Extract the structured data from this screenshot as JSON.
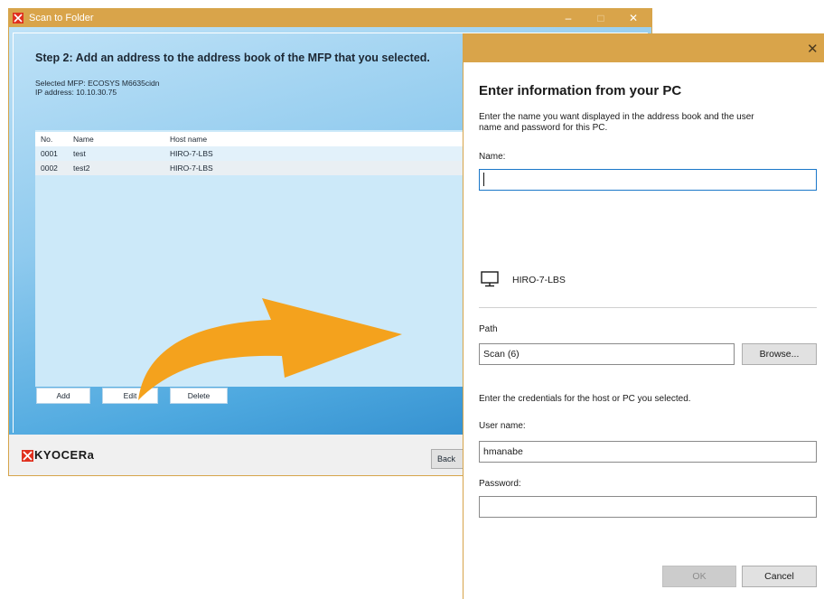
{
  "main_window": {
    "title": "Scan to Folder",
    "controls": {
      "minimize": "–",
      "maximize": "□",
      "close": "✕"
    },
    "step_title": "Step 2:  Add an address to the address book of the MFP that you selected.",
    "selected_mfp": "Selected MFP: ECOSYS M6635cidn",
    "ip_address": "IP address: 10.10.30.75",
    "table": {
      "headers": {
        "no": "No.",
        "name": "Name",
        "host": "Host name"
      },
      "rows": [
        {
          "no": "0001",
          "name": "test",
          "host": "HIRO-7-LBS"
        },
        {
          "no": "0002",
          "name": "test2",
          "host": "HIRO-7-LBS"
        }
      ]
    },
    "buttons": {
      "add": "Add",
      "edit": "Edit",
      "delete": "Delete"
    },
    "logo_text": "KYOCERa",
    "back_button": "Back",
    "colors": {
      "titlebar": "#d9a44a",
      "arrow": "#f4a21d",
      "logo_red": "#e0311f"
    }
  },
  "dialog": {
    "close": "✕",
    "heading": "Enter information from your PC",
    "instruction_line1": "Enter the name you want displayed in the address book and the user",
    "instruction_line2": "name and password for this PC.",
    "name_label": "Name:",
    "name_value": "",
    "host_icon": "monitor-icon",
    "host_name": "HIRO-7-LBS",
    "path_label": "Path",
    "path_value": "Scan (6)",
    "browse_button": "Browse...",
    "credentials_text": "Enter the credentials for the host or PC you selected.",
    "username_label": "User name:",
    "username_value": "hmanabe",
    "password_label": "Password:",
    "password_value": "",
    "ok_button": "OK",
    "cancel_button": "Cancel"
  }
}
